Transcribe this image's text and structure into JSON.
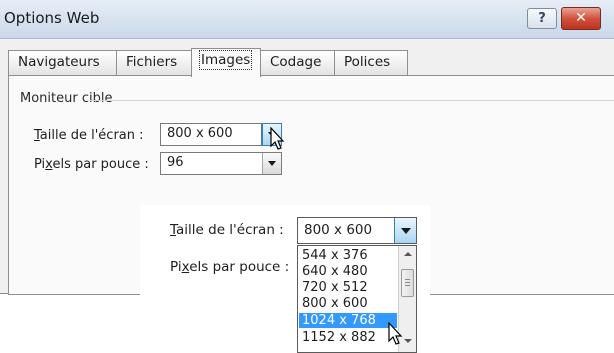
{
  "window": {
    "title": "Options Web",
    "help_label": "?",
    "close_label": "✕"
  },
  "tabs": [
    {
      "label": "Navigateurs"
    },
    {
      "label": "Fichiers"
    },
    {
      "label": "Images",
      "active": true
    },
    {
      "label": "Codage"
    },
    {
      "label": "Polices"
    }
  ],
  "group": {
    "label": "Moniteur cible"
  },
  "screen_size": {
    "label_prefix": "T",
    "label_rest": "aille de l'écran :",
    "value": "800 x 600"
  },
  "pixels_per_inch": {
    "label_a": "Pi",
    "label_u": "x",
    "label_b": "els par pouce :",
    "value": "96"
  },
  "zoom": {
    "screen_size_value": "800 x 600",
    "options": [
      "544 x 376",
      "640 x 480",
      "720 x 512",
      "800 x 600",
      "1024 x 768",
      "1152 x 882"
    ],
    "selected_option": "1024 x 768"
  },
  "colors": {
    "selection": "#3399ff",
    "close_button": "#c9452f",
    "titlebar": "#d6e2ef"
  }
}
